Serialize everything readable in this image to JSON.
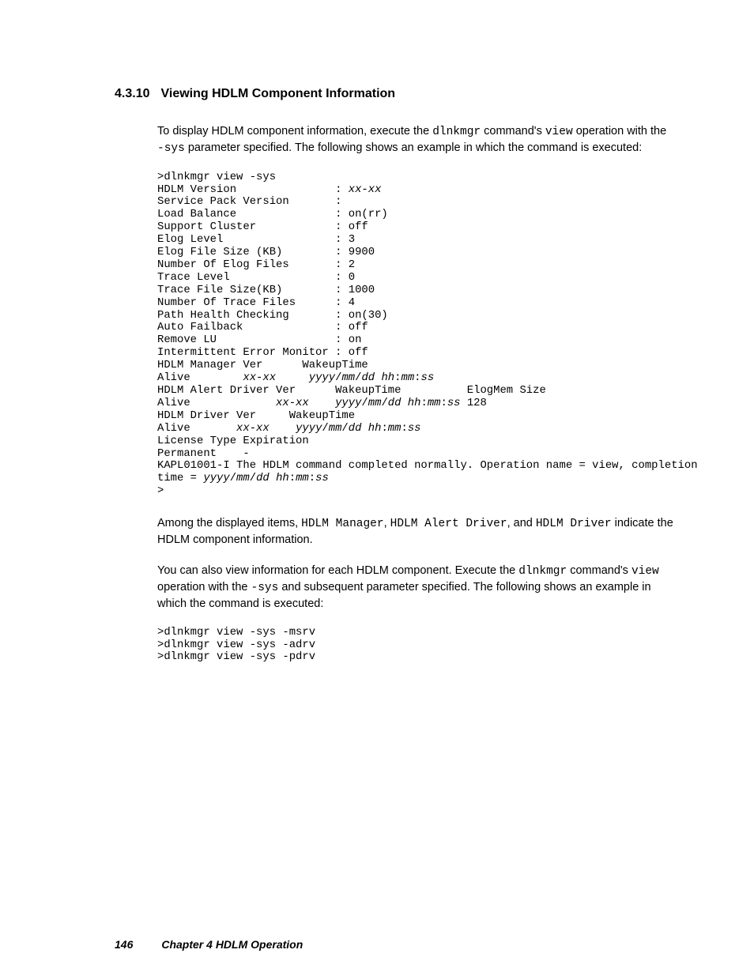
{
  "heading": {
    "number": "4.3.10",
    "title": "Viewing HDLM Component Information"
  },
  "para1": {
    "pre1": "To display HDLM component information, execute the ",
    "code1": "dlnkmgr",
    "mid1": " command's ",
    "code2": "view",
    "mid2": " operation with the ",
    "code3": "-sys",
    "post": " parameter specified. The following shows an example in which the command is executed:"
  },
  "code1": {
    "l01": ">dlnkmgr view -sys",
    "l02a": "HDLM Version               : ",
    "l02b": "xx-xx",
    "l03": "Service Pack Version       :",
    "l04": "Load Balance               : on(rr)",
    "l05": "Support Cluster            : off",
    "l06": "Elog Level                 : 3",
    "l07": "Elog File Size (KB)        : 9900",
    "l08": "Number Of Elog Files       : 2",
    "l09": "Trace Level                : 0",
    "l10": "Trace File Size(KB)        : 1000",
    "l11": "Number Of Trace Files      : 4",
    "l12": "Path Health Checking       : on(30)",
    "l13": "Auto Failback              : off",
    "l14": "Remove LU                  : on",
    "l15": "Intermittent Error Monitor : off",
    "l16": "HDLM Manager Ver      WakeupTime",
    "l17a": "Alive        ",
    "l17b": "xx-xx",
    "l17c": "     ",
    "l17d": "yyyy",
    "l17e": "/",
    "l17f": "mm",
    "l17g": "/",
    "l17h": "dd",
    "l17i": " ",
    "l17j": "hh",
    "l17k": ":",
    "l17l": "mm",
    "l17m": ":",
    "l17n": "ss",
    "l18": "HDLM Alert Driver Ver      WakeupTime          ElogMem Size",
    "l19a": "Alive             ",
    "l19b": "xx-xx",
    "l19c": "    ",
    "l19d": "yyyy",
    "l19e": "/",
    "l19f": "mm",
    "l19g": "/",
    "l19h": "dd",
    "l19i": " ",
    "l19j": "hh",
    "l19k": ":",
    "l19l": "mm",
    "l19m": ":",
    "l19n": "ss",
    "l19o": " 128",
    "l20": "HDLM Driver Ver     WakeupTime",
    "l21a": "Alive       ",
    "l21b": "xx-xx",
    "l21c": "    ",
    "l21d": "yyyy",
    "l21e": "/",
    "l21f": "mm",
    "l21g": "/",
    "l21h": "dd",
    "l21i": " ",
    "l21j": "hh",
    "l21k": ":",
    "l21l": "mm",
    "l21m": ":",
    "l21n": "ss",
    "l22": "License Type Expiration",
    "l23": "Permanent    -",
    "l24": "KAPL01001-I The HDLM command completed normally. Operation name = view, completion ",
    "l25a": "time = ",
    "l25b": "yyyy",
    "l25c": "/",
    "l25d": "mm",
    "l25e": "/",
    "l25f": "dd",
    "l25g": " ",
    "l25h": "hh",
    "l25i": ":",
    "l25j": "mm",
    "l25k": ":",
    "l25l": "ss",
    "l26": ">"
  },
  "para2": {
    "pre1": "Among the displayed items, ",
    "code1": "HDLM Manager",
    "mid1": ", ",
    "code2": "HDLM Alert Driver",
    "mid2": ", and ",
    "code3": "HDLM Driver",
    "post": " indicate the HDLM component information."
  },
  "para3": {
    "pre1": "You can also view information for each HDLM component. Execute the ",
    "code1": "dlnkmgr",
    "mid1": " command's ",
    "code2": "view",
    "mid2": " operation with the ",
    "code3": "-sys",
    "post": " and subsequent parameter specified. The following shows an example in which the command is executed:"
  },
  "code2": {
    "l1": ">dlnkmgr view -sys -msrv",
    "l2": ">dlnkmgr view -sys -adrv",
    "l3": ">dlnkmgr view -sys -pdrv"
  },
  "footer": {
    "page": "146",
    "chapter": "Chapter 4   HDLM Operation"
  }
}
